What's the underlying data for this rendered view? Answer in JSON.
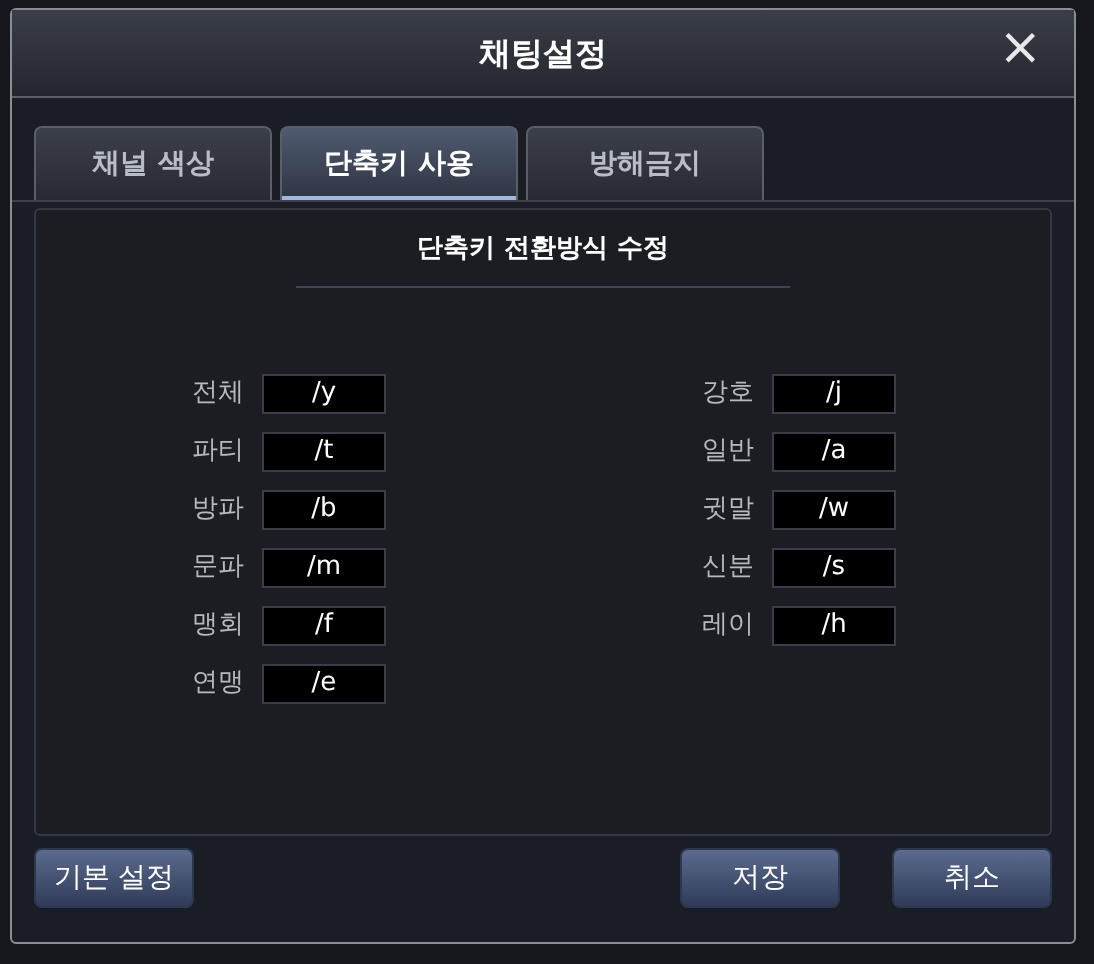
{
  "window": {
    "title": "채팅설정",
    "close": "×"
  },
  "tabs": [
    {
      "label": "채널 색상",
      "selected": false
    },
    {
      "label": "단축키 사용",
      "selected": true
    },
    {
      "label": "방해금지",
      "selected": false
    }
  ],
  "section_title": "단축키 전환방식 수정",
  "columns": [
    [
      {
        "label": "전체",
        "value": "/y"
      },
      {
        "label": "파티",
        "value": "/t"
      },
      {
        "label": "방파",
        "value": "/b"
      },
      {
        "label": "문파",
        "value": "/m"
      },
      {
        "label": "맹회",
        "value": "/f"
      },
      {
        "label": "연맹",
        "value": "/e"
      }
    ],
    [
      {
        "label": "강호",
        "value": "/j"
      },
      {
        "label": "일반",
        "value": "/a"
      },
      {
        "label": "귓말",
        "value": "/w"
      },
      {
        "label": "신분",
        "value": "/s"
      },
      {
        "label": "레이",
        "value": "/h"
      }
    ]
  ],
  "buttons": [
    {
      "label": "기본 설정",
      "kind": "left"
    },
    {
      "label": "저장",
      "kind": "right"
    },
    {
      "label": "취소",
      "kind": "right"
    }
  ]
}
